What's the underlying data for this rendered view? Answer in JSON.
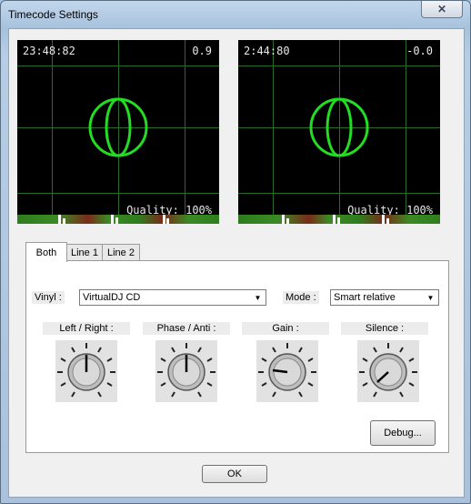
{
  "window": {
    "title": "Timecode Settings",
    "close_icon": "close-icon"
  },
  "scopes": [
    {
      "time": "23:48:82",
      "speed": "0.9",
      "quality": "Quality: 100%"
    },
    {
      "time": "2:44:80",
      "speed": "-0.0",
      "quality": "Quality: 100%"
    }
  ],
  "tabs": [
    {
      "label": "Both",
      "active": true
    },
    {
      "label": "Line 1",
      "active": false
    },
    {
      "label": "Line 2",
      "active": false
    }
  ],
  "vinyl": {
    "label": "Vinyl :",
    "value": "VirtualDJ CD"
  },
  "mode": {
    "label": "Mode :",
    "value": "Smart relative"
  },
  "knobs": [
    {
      "label": "Left / Right :"
    },
    {
      "label": "Phase / Anti :"
    },
    {
      "label": "Gain :"
    },
    {
      "label": "Silence :"
    }
  ],
  "buttons": {
    "debug": "Debug...",
    "ok": "OK"
  },
  "colors": {
    "scope_trace": "#22dd22",
    "scope_bg": "#000000"
  }
}
